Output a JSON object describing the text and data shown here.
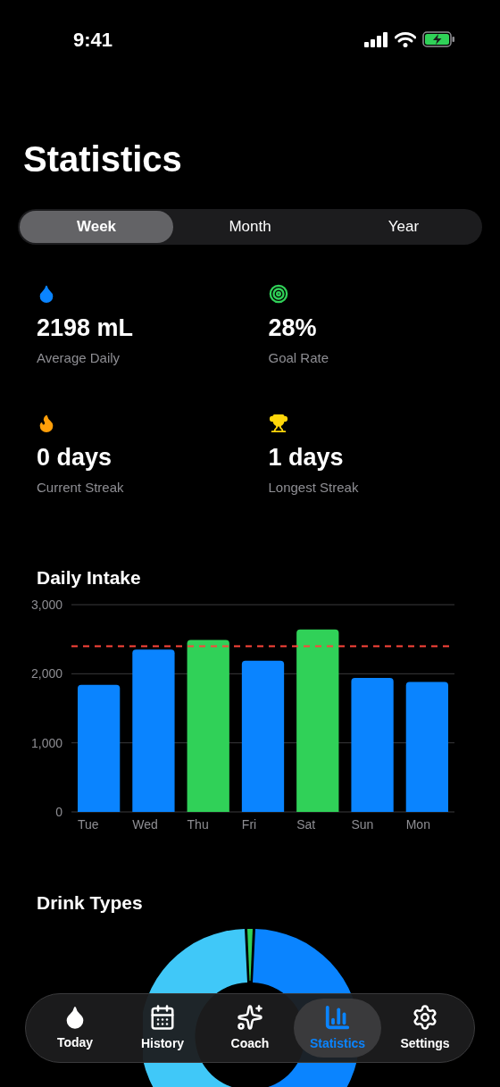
{
  "status_bar": {
    "time": "9:41"
  },
  "title": "Statistics",
  "period_tabs": [
    {
      "label": "Week",
      "selected": true
    },
    {
      "label": "Month",
      "selected": false
    },
    {
      "label": "Year",
      "selected": false
    }
  ],
  "stats": [
    {
      "kind": "drop",
      "value": "2198 mL",
      "label": "Average Daily"
    },
    {
      "kind": "target",
      "value": "28%",
      "label": "Goal Rate"
    },
    {
      "kind": "flame",
      "value": "0 days",
      "label": "Current Streak"
    },
    {
      "kind": "trophy",
      "value": "1 days",
      "label": "Longest Streak"
    }
  ],
  "daily_intake": {
    "title": "Daily Intake",
    "chart_data": {
      "type": "bar",
      "categories": [
        "Tue",
        "Wed",
        "Thu",
        "Fri",
        "Sat",
        "Sun",
        "Mon"
      ],
      "series": [
        {
          "color": "#0a84ff",
          "values": [
            1840,
            2350,
            null,
            2190,
            null,
            1940,
            1880
          ]
        },
        {
          "color": "#30d158",
          "values": [
            null,
            null,
            2490,
            null,
            2640,
            null,
            null
          ]
        }
      ],
      "ylim": [
        0,
        3000
      ],
      "yticks": [
        {
          "value": 0,
          "label": "0"
        },
        {
          "value": 1000,
          "label": "1,000"
        },
        {
          "value": 2000,
          "label": "2,000"
        },
        {
          "value": 3000,
          "label": "3,000"
        }
      ],
      "ref_lines": [
        {
          "axis": "y",
          "value": 2400,
          "color": "#ff453a"
        }
      ]
    }
  },
  "drink_types": {
    "title": "Drink Types"
  },
  "tab_bar": [
    {
      "kind": "drop",
      "label": "Today",
      "selected": false
    },
    {
      "kind": "calendar",
      "label": "History",
      "selected": false
    },
    {
      "kind": "sparkles",
      "label": "Coach",
      "selected": false
    },
    {
      "kind": "chart",
      "label": "Statistics",
      "selected": true
    },
    {
      "kind": "gear",
      "label": "Settings",
      "selected": false
    }
  ]
}
